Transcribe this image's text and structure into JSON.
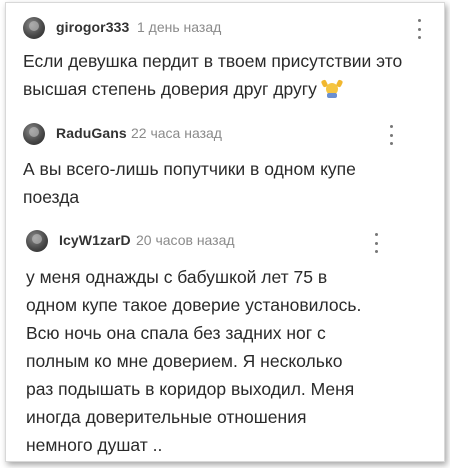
{
  "comments": [
    {
      "username": "girogor333",
      "time": "1 день назад",
      "text": "Если девушка пердит в твоем присутствии это\nвысшая степень доверия друг другу",
      "emoji": "person-raising-hands-emoji"
    },
    {
      "username": "RaduGans",
      "time": "22 часа назад",
      "text": "А вы всего-лишь попутчики в одном купе\nпоезда"
    },
    {
      "username": "IcyW1zarD",
      "time": "20 часов назад",
      "text": "у меня однажды с бабушкой лет 75 в\nодном купе такое доверие установилось.\nВсю ночь она спала без задних ног с\nполным ко мне доверием. Я несколько\nраз подышать в коридор выходил. Меня\nиногда доверительные отношения\nнемного душат .."
    }
  ],
  "icons": {
    "menu": "more-vertical-icon",
    "avatar": "avatar"
  }
}
